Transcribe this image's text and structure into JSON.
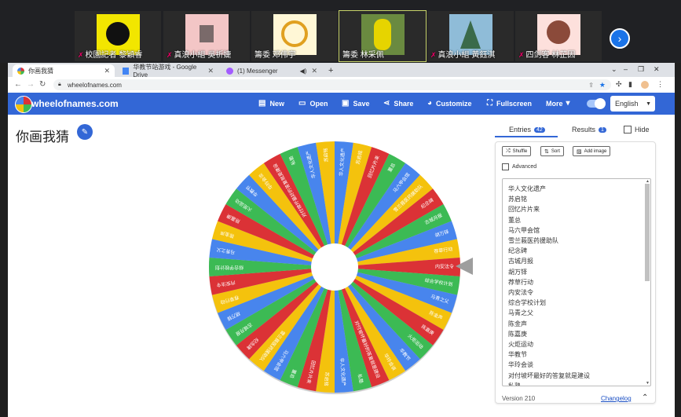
{
  "meet": {
    "participants": [
      {
        "name": "校園記者 黎穎睿",
        "colors": [
          "#f2e600",
          "#111"
        ],
        "active": false
      },
      {
        "name": "真浪小組 吳祈婕",
        "colors": [
          "#f3c6c6",
          "#7a6a6a"
        ],
        "active": false
      },
      {
        "name": "籌委 邓伟宇",
        "colors": [
          "#fff7d6",
          "#e0a020"
        ],
        "active": false
      },
      {
        "name": "籌委 林采佩",
        "colors": [
          "#6a8a40",
          "#e6d400"
        ],
        "active": true
      },
      {
        "name": "真浪小組 黃鈺淇",
        "colors": [
          "#8fbcd8",
          "#3a6a4a"
        ],
        "active": false
      },
      {
        "name": "四剑客 林芷因",
        "colors": [
          "#fde0dc",
          "#8b4a3a"
        ],
        "active": false
      }
    ],
    "next_icon": "chevron-right-icon"
  },
  "browser": {
    "tabs": [
      {
        "title": "你画我猜",
        "color": "#e65",
        "active": true
      },
      {
        "title": "华教节站游戏 - Google Drive",
        "color": "#4285f4",
        "active": false
      },
      {
        "title": "(1) Messenger",
        "color": "#a35cff",
        "active": false
      }
    ],
    "new_tab": "+",
    "url": "wheelofnames.com",
    "window_controls": [
      "⌄",
      "–",
      "❐",
      "✕"
    ]
  },
  "app": {
    "brand": "wheelofnames.com",
    "menu": [
      {
        "label": "New",
        "icon": "new-file-icon",
        "glyph": "▤"
      },
      {
        "label": "Open",
        "icon": "folder-open-icon",
        "glyph": "▭"
      },
      {
        "label": "Save",
        "icon": "save-icon",
        "glyph": "▣"
      },
      {
        "label": "Share",
        "icon": "share-icon",
        "glyph": "⋖"
      },
      {
        "label": "Customize",
        "icon": "palette-icon",
        "glyph": "◕"
      },
      {
        "label": "Fullscreen",
        "icon": "fullscreen-icon",
        "glyph": "⛶"
      },
      {
        "label": "More",
        "icon": "dropdown-icon",
        "glyph": "▾"
      }
    ],
    "language": "English"
  },
  "wheel": {
    "title": "你画我猜",
    "colors": [
      "#4885ed",
      "#f4c20d",
      "#db3236",
      "#3cba54"
    ]
  },
  "panel": {
    "tabs": {
      "entries_label": "Entries",
      "entries_count": "42",
      "results_label": "Results",
      "results_count": "1",
      "hide_label": "Hide"
    },
    "buttons": {
      "shuffle": "Shuffle",
      "sort": "Sort",
      "add_image": "Add image"
    },
    "advanced": "Advanced",
    "entries": [
      "华人文化遗产",
      "苏启铭",
      "回忆片片来",
      "董总",
      "马六甲会馆",
      "雪兰莪医药援助队",
      "纪念碑",
      "古城月报",
      "胡万铎",
      "荐草行动",
      "内安法令",
      "综合学校计划",
      "马青之父",
      "陈金声",
      "陈嘉庚",
      "火炬运动",
      "华教节",
      "华玲会谈",
      "对付坡坏最好的答复就是建设",
      "私塾"
    ],
    "version": "Version 210",
    "changelog": "Changelog"
  }
}
